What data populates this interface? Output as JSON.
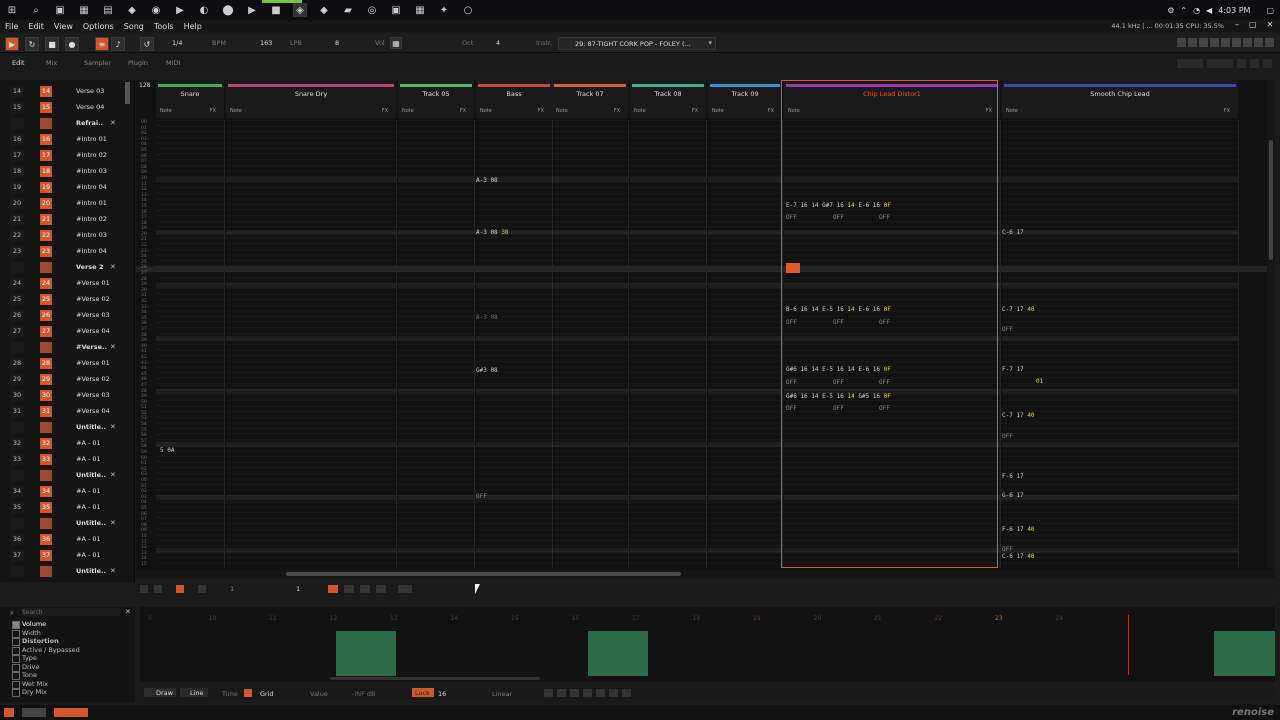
{
  "menu": {
    "items": [
      "File",
      "Edit",
      "View",
      "Options",
      "Song",
      "Tools",
      "Help"
    ]
  },
  "stats": {
    "text": "44.1 kHz | ... 00:01:35 CPU: 35.5%"
  },
  "clock": {
    "time": "4:03 PM"
  },
  "transport": {
    "octave_fraction": "1/4",
    "bpm_label": "BPM",
    "bpm": "163",
    "lpb_label": "LPB",
    "lpb": "8",
    "vol_label": "Vol",
    "oct_label": "Oct",
    "oct": "4",
    "instr_label": "Instr.",
    "instrument": "29: 87-TIGHT CORK POP - FOLEY (..."
  },
  "tabs": {
    "edit": "Edit",
    "mix": "Mix",
    "sampler": "Sampler",
    "plugin": "Plugin",
    "midi": "MIDI"
  },
  "sequence": [
    {
      "n1": "14",
      "n2": "14",
      "name": "Verse 03"
    },
    {
      "n1": "15",
      "n2": "15",
      "name": "Verse 04"
    },
    {
      "n1": "",
      "n2": "",
      "name": "Refrai..",
      "bold": true
    },
    {
      "n1": "16",
      "n2": "16",
      "name": "#Intro 01"
    },
    {
      "n1": "17",
      "n2": "17",
      "name": "#Intro 02"
    },
    {
      "n1": "18",
      "n2": "18",
      "name": "#Intro 03"
    },
    {
      "n1": "19",
      "n2": "19",
      "name": "#Intro 04"
    },
    {
      "n1": "20",
      "n2": "20",
      "name": "#Intro 01"
    },
    {
      "n1": "21",
      "n2": "21",
      "name": "#Intro 02"
    },
    {
      "n1": "22",
      "n2": "22",
      "name": "#Intro 03"
    },
    {
      "n1": "23",
      "n2": "23",
      "name": "#Intro 04"
    },
    {
      "n1": "",
      "n2": "",
      "name": "Verse 2",
      "bold": true
    },
    {
      "n1": "24",
      "n2": "24",
      "name": "#Verse 01"
    },
    {
      "n1": "25",
      "n2": "25",
      "name": "#Verse 02"
    },
    {
      "n1": "26",
      "n2": "26",
      "name": "#Verse 03"
    },
    {
      "n1": "27",
      "n2": "27",
      "name": "#Verse 04"
    },
    {
      "n1": "",
      "n2": "",
      "name": "#Verse..",
      "bold": true
    },
    {
      "n1": "28",
      "n2": "28",
      "name": "#Verse 01"
    },
    {
      "n1": "29",
      "n2": "29",
      "name": "#Verse 02"
    },
    {
      "n1": "30",
      "n2": "30",
      "name": "#Verse 03"
    },
    {
      "n1": "31",
      "n2": "31",
      "name": "#Verse 04"
    },
    {
      "n1": "",
      "n2": "",
      "name": "Untitle..",
      "bold": true
    },
    {
      "n1": "32",
      "n2": "32",
      "name": "#A - 01"
    },
    {
      "n1": "33",
      "n2": "33",
      "name": "#A - 01"
    },
    {
      "n1": "",
      "n2": "",
      "name": "Untitle..",
      "bold": true
    },
    {
      "n1": "34",
      "n2": "34",
      "name": "#A - 01"
    },
    {
      "n1": "35",
      "n2": "35",
      "name": "#A - 01"
    },
    {
      "n1": "",
      "n2": "",
      "name": "Untitle..",
      "bold": true
    },
    {
      "n1": "36",
      "n2": "36",
      "name": "#A - 01"
    },
    {
      "n1": "37",
      "n2": "37",
      "name": "#A - 01"
    },
    {
      "n1": "",
      "n2": "",
      "name": "Untitle..",
      "bold": true
    }
  ],
  "pattern": {
    "lines_count": "128",
    "tracks": [
      {
        "name": "Snare",
        "color": "#3fae5a",
        "note": "Note",
        "fx": "FX"
      },
      {
        "name": "Snare Dry",
        "color": "#c0437a",
        "note": "Note",
        "fx": "FX"
      },
      {
        "name": "Track 05",
        "color": "#5ab36b",
        "note": "Note",
        "fx": "FX"
      },
      {
        "name": "Bass",
        "color": "#c94a4a",
        "note": "Note",
        "fx": "FX"
      },
      {
        "name": "Track 07",
        "color": "#d4603a",
        "note": "Note",
        "fx": "FX"
      },
      {
        "name": "Track 08",
        "color": "#3ab08d",
        "note": "Note",
        "fx": "FX"
      },
      {
        "name": "Track 09",
        "color": "#3a8fd4",
        "note": "Note",
        "fx": "FX"
      },
      {
        "name": "Chip Lead Distor1",
        "color": "#9a3ab8",
        "note": "Note",
        "fx": "FX"
      },
      {
        "name": "Smooth Chip Lead",
        "color": "#3a4ab8",
        "note": "Note",
        "fx": "FX"
      }
    ],
    "notes": {
      "bass1": "A-3 08",
      "bass2": "A-3 08",
      "bass2vol": "30",
      "bass3": "A-3 08",
      "bass4": "G#3 08",
      "bassoff": "OFF",
      "snare_row": "5 0A",
      "chip1": "E-7 16",
      "chip1b": "G#7 16",
      "chip1c": "E-6 16",
      "chip2": "B-6 16",
      "chip2b": "E-5 16",
      "chip2c": "E-6 16",
      "chip3": "G#6 16",
      "chip3b": "E-5 16",
      "chip3c": "E-6 16",
      "chip4": "G#6 16",
      "chip4b": "E-5 16",
      "chip4c": "G#5 16",
      "vol": "14",
      "fxval": "0F",
      "lead1": "C-6 17",
      "lead2": "C-7 17",
      "lead2v": "40",
      "lead3": "F-7 17",
      "lead3v": "01",
      "lead4": "C-7 17",
      "lead4v": "40",
      "lead5": "F-6 17",
      "lead6": "G-6 17",
      "lead7": "F-6 17",
      "lead7v": "40",
      "lead8": "C-6 17",
      "lead8v": "40",
      "off": "OFF"
    }
  },
  "pattern_toolbar": {
    "val1": "1",
    "val2": "1"
  },
  "automation": {
    "search_placeholder": "Search",
    "params": [
      "Volume",
      "Width",
      "Distortion",
      "Active / Bypassed",
      "Type",
      "Drive",
      "Tone",
      "Wet Mix",
      "Dry Mix"
    ],
    "ruler": [
      "9",
      "10",
      "11",
      "12",
      "13",
      "14",
      "15",
      "16",
      "17",
      "18",
      "19",
      "20",
      "21",
      "22",
      "23",
      "24"
    ],
    "current": "23",
    "tools": {
      "draw": "Draw",
      "line": "Line",
      "time": "Time",
      "grid": "Grid",
      "value": "Value",
      "value_readout": "-INF dB",
      "lock": "Lock",
      "lock_val": "16",
      "interp": "Linear"
    }
  },
  "brand": {
    "logo": "renoise"
  },
  "colors": {
    "accent": "#e05a2a",
    "automation": "#2e6b4a"
  }
}
